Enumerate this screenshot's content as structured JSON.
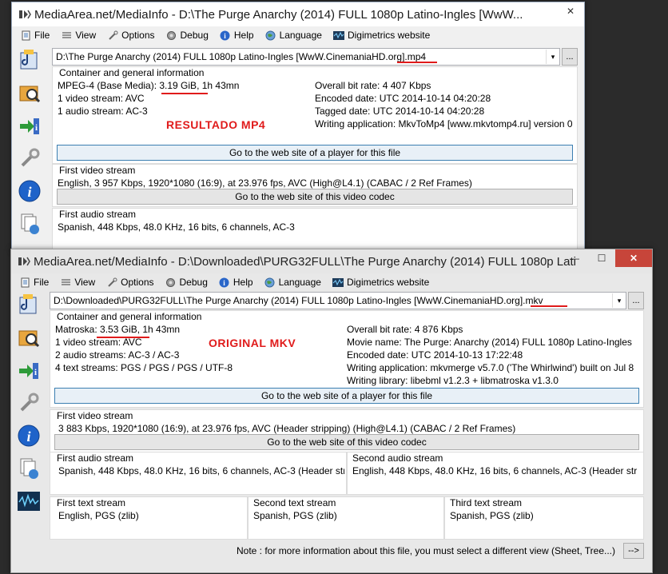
{
  "colors": {
    "annotation": "#e01b1b",
    "close": "#c7453a"
  },
  "menu": {
    "file": "File",
    "view": "View",
    "options": "Options",
    "debug": "Debug",
    "help": "Help",
    "language": "Language",
    "digimetrics": "Digimetrics website"
  },
  "window_top": {
    "title": "MediaArea.net/MediaInfo - D:\\The Purge Anarchy (2014) FULL 1080p Latino-Ingles [WwW...",
    "menu_view": "View",
    "menu_debug": "Debug",
    "file_path": "D:\\The Purge Anarchy (2014) FULL 1080p Latino-Ingles [WwW.CinemaniaHD.org].mp4",
    "container_title": "Container and general information",
    "left_lines": [
      "MPEG-4 (Base Media): 3.19 GiB, 1h 43mn",
      "1 video stream: AVC",
      "1 audio stream: AC-3"
    ],
    "right_lines": [
      "Overall bit rate: 4 407 Kbps",
      "Encoded date: UTC 2014-10-14 04:20:28",
      "Tagged date: UTC 2014-10-14 04:20:28",
      "Writing application: MkvToMp4 [www.mkvtomp4.ru] version 0"
    ],
    "annotation": "RESULTADO MP4",
    "player_button": "Go to the web site of a player for this file",
    "video_title": "First video stream",
    "video_line": "English, 3 957 Kbps, 1920*1080 (16:9), at 23.976 fps, AVC (High@L4.1) (CABAC / 2 Ref Frames)",
    "codec_button": "Go to the web site of this video codec",
    "audio_title": "First audio stream",
    "audio_line": "Spanish, 448 Kbps, 48.0 KHz, 16 bits, 6 channels, AC-3"
  },
  "window_bottom": {
    "title": "MediaArea.net/MediaInfo - D:\\Downloaded\\PURG32FULL\\The Purge Anarchy (2014) FULL 1080p Lati...",
    "file_path": "D:\\Downloaded\\PURG32FULL\\The Purge Anarchy (2014) FULL 1080p Latino-Ingles [WwW.CinemaniaHD.org].mkv",
    "container_title": "Container and general information",
    "left_lines": [
      "Matroska: 3.53 GiB, 1h 43mn",
      "1 video stream: AVC",
      "2 audio streams: AC-3 / AC-3",
      "4 text streams: PGS / PGS / PGS / UTF-8"
    ],
    "right_lines": [
      "Overall bit rate: 4 876 Kbps",
      "Movie name: The Purge: Anarchy (2014) FULL 1080p Latino-Ingles",
      "Encoded date: UTC 2014-10-13 17:22:48",
      "Writing application: mkvmerge v5.7.0 ('The Whirlwind') built on Jul 8",
      "Writing library: libebml v1.2.3 + libmatroska v1.3.0"
    ],
    "annotation": "ORIGINAL MKV",
    "player_button": "Go to the web site of a player for this file",
    "video_title": "First video stream",
    "video_line": "3 883 Kbps, 1920*1080 (16:9), at 23.976 fps, AVC (Header stripping) (High@L4.1) (CABAC / 2 Ref Frames)",
    "codec_button": "Go to the web site of this video codec",
    "audio1_title": "First audio stream",
    "audio1_line": "Spanish, 448 Kbps, 48.0 KHz, 16 bits, 6 channels, AC-3 (Header str",
    "audio2_title": "Second audio stream",
    "audio2_line": "English, 448 Kbps, 48.0 KHz, 16 bits, 6 channels, AC-3 (Header str",
    "text1_title": "First text stream",
    "text1_line": "English, PGS (zlib)",
    "text2_title": "Second text stream",
    "text2_line": "Spanish, PGS (zlib)",
    "text3_title": "Third text stream",
    "text3_line": "Spanish, PGS (zlib)",
    "note": "Note : for more information about this file, you must select a different view (Sheet, Tree...)",
    "arrow_button": "-->"
  },
  "controls": {
    "minimize": "—",
    "maximize": "☐",
    "close": "✕",
    "dropdown": "▾",
    "ellipsis": "..."
  }
}
